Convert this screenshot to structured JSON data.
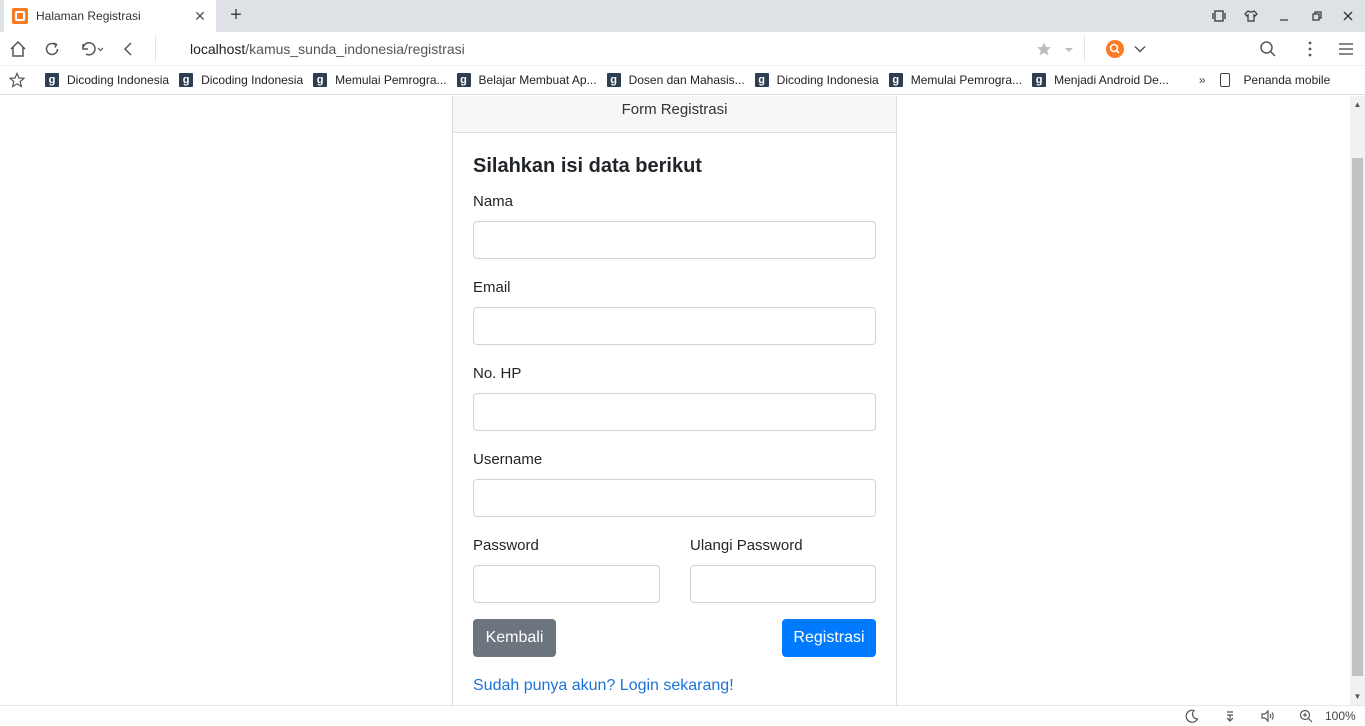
{
  "browser": {
    "tab_title": "Halaman Registrasi",
    "url_host": "localhost",
    "url_path": "/kamus_sunda_indonesia/registrasi",
    "bookmarks": [
      "Dicoding Indonesia",
      "Dicoding Indonesia",
      "Memulai Pemrogra...",
      "Belajar Membuat Ap...",
      "Dosen dan Mahasis...",
      "Dicoding Indonesia",
      "Memulai Pemrogra...",
      "Menjadi Android De..."
    ],
    "bookmarks_more": "»",
    "mobile_bookmarks": "Penanda mobile",
    "zoom": "100%",
    "colors": {
      "accent": "#fb7a24",
      "tabstrip": "#dee1e6"
    }
  },
  "form": {
    "header": "Form Registrasi",
    "title": "Silahkan isi data berikut",
    "labels": {
      "name": "Nama",
      "email": "Email",
      "phone": "No. HP",
      "username": "Username",
      "password": "Password",
      "confirm_password": "Ulangi Password"
    },
    "values": {
      "name": "",
      "email": "",
      "phone": "",
      "username": "",
      "password": "",
      "confirm_password": ""
    },
    "back_button": "Kembali",
    "submit_button": "Registrasi",
    "login_link": "Sudah punya akun? Login sekarang!",
    "colors": {
      "primary": "#007bff",
      "secondary": "#6c757d",
      "link": "#1a73d9"
    }
  }
}
